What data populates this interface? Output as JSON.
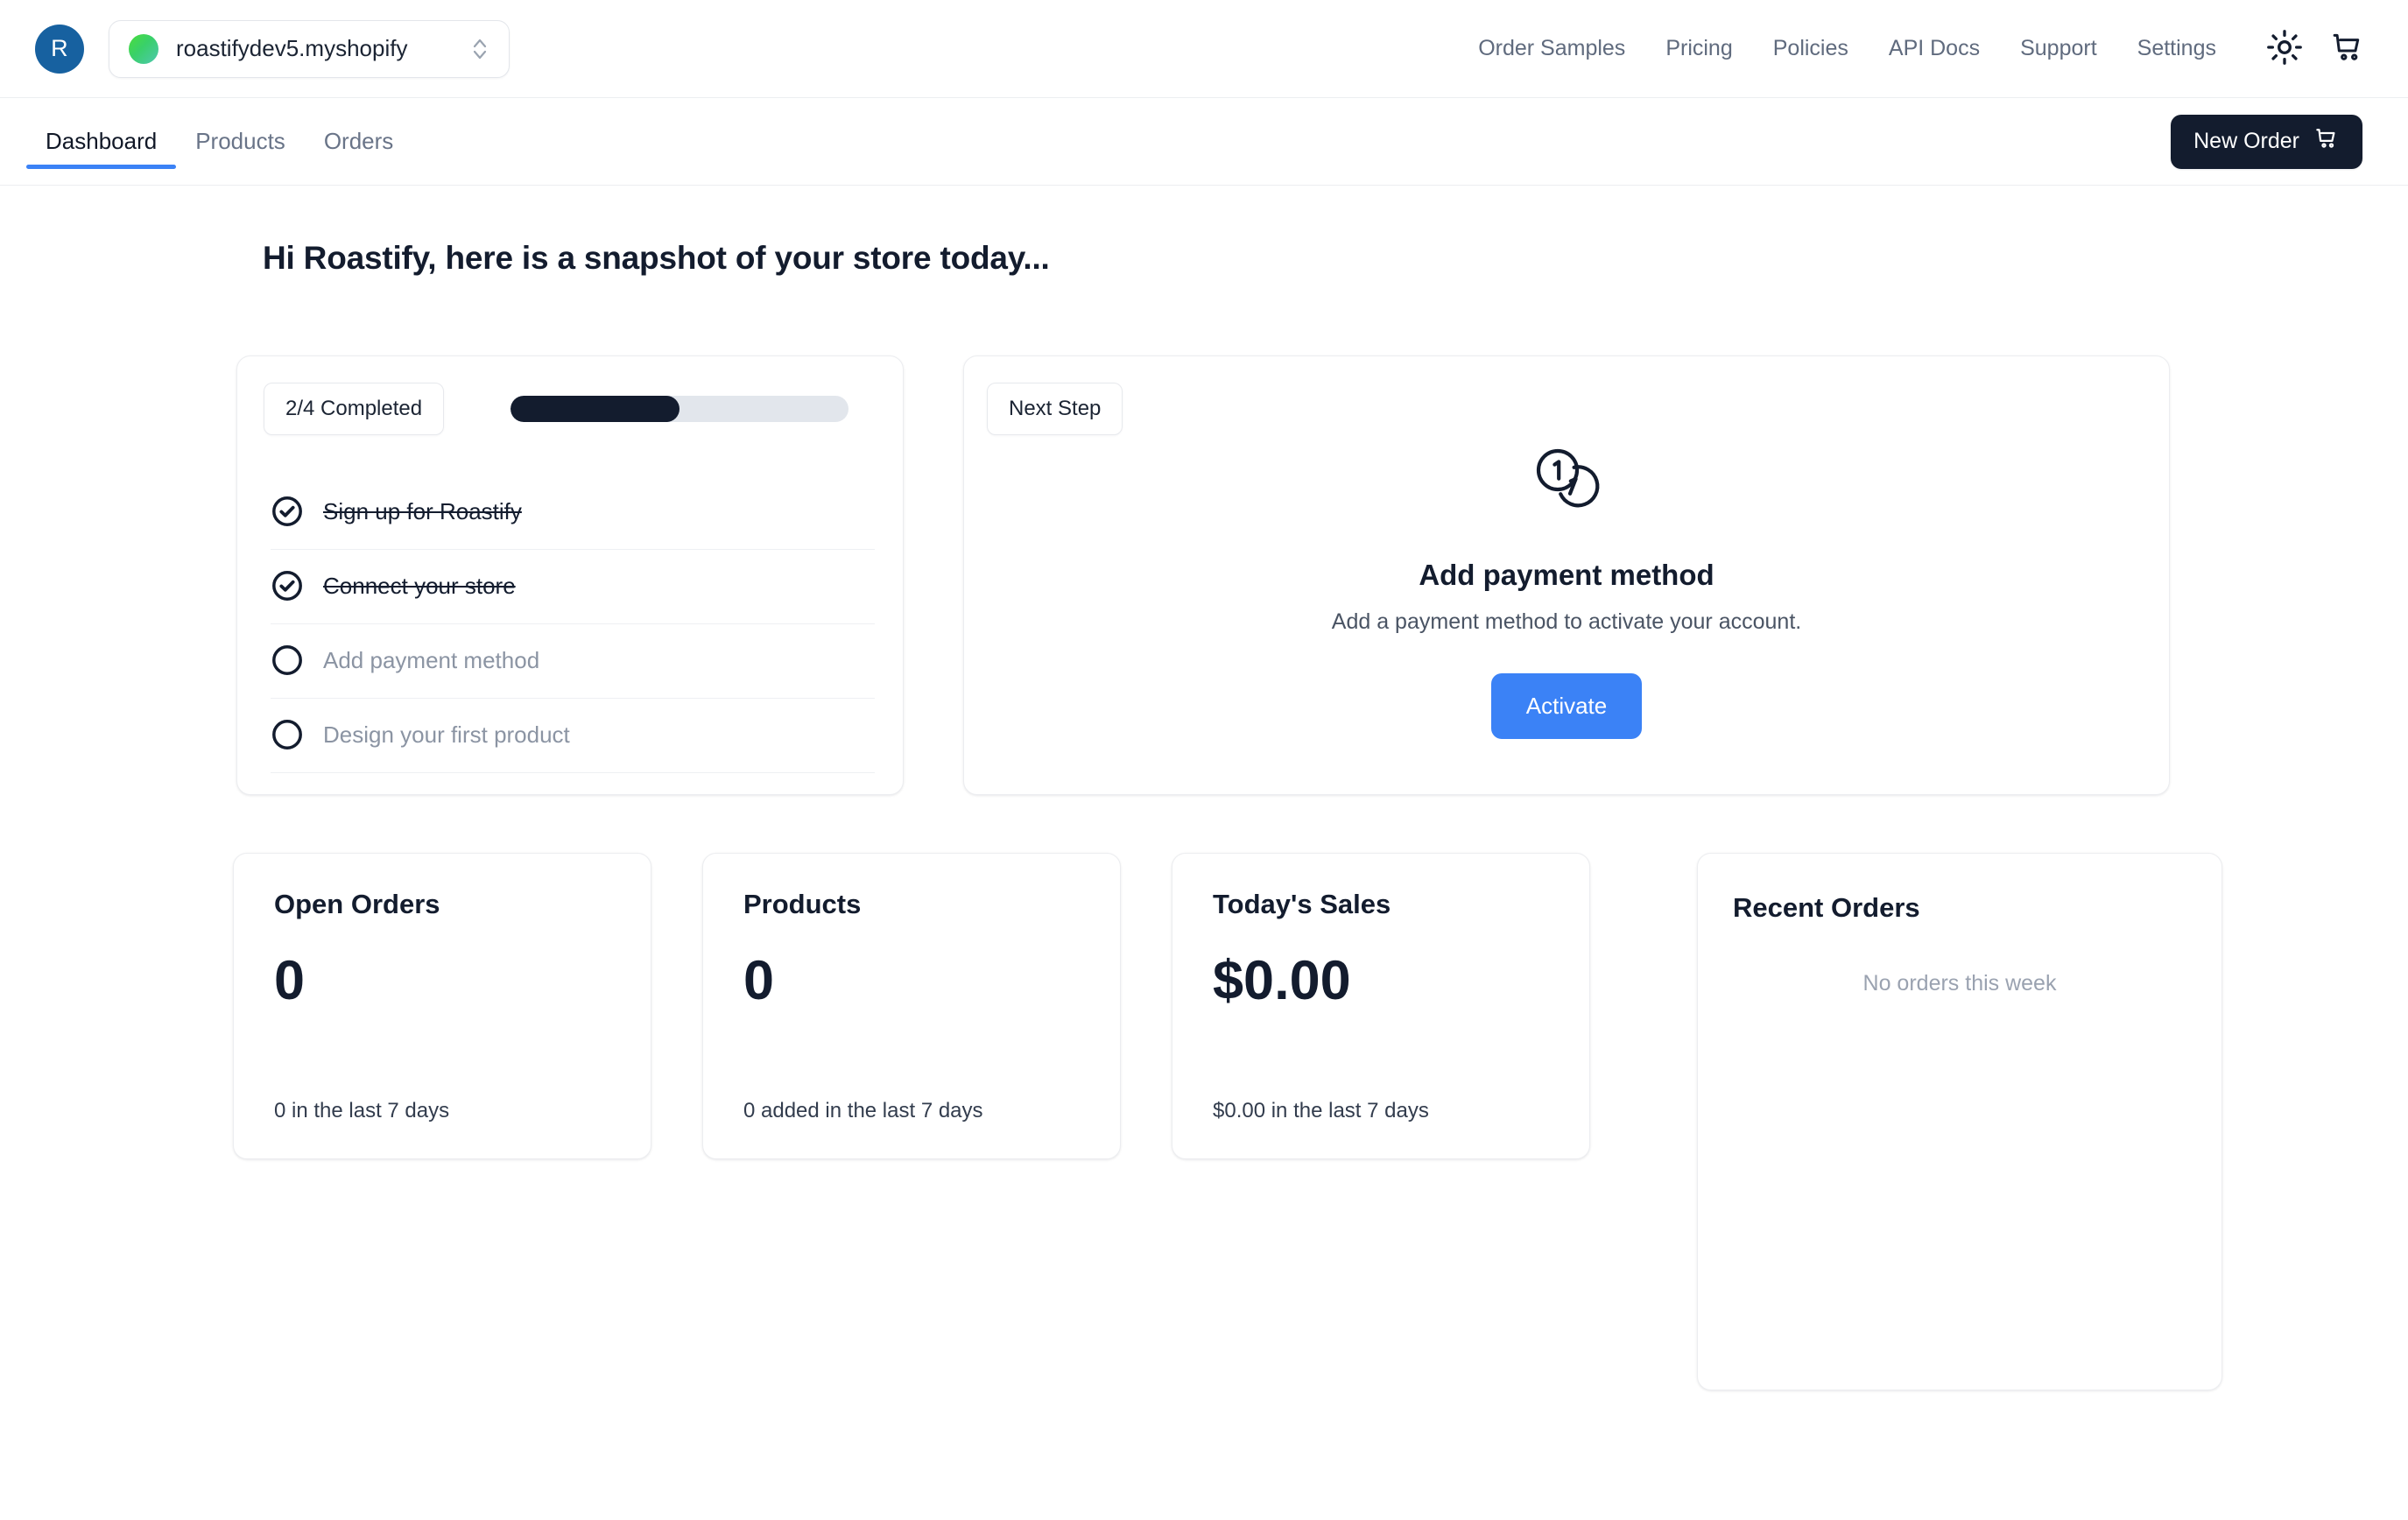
{
  "topbar": {
    "avatar_initial": "R",
    "store": {
      "name": "roastifydev5.myshopify",
      "status_dot": "online-status-dot",
      "chevron_icon": "chevron-up-down-icon"
    },
    "nav": [
      {
        "label": "Order Samples"
      },
      {
        "label": "Pricing"
      },
      {
        "label": "Policies"
      },
      {
        "label": "API Docs"
      },
      {
        "label": "Support"
      },
      {
        "label": "Settings"
      }
    ],
    "theme_toggle_icon": "sun-icon",
    "cart_icon": "shopping-cart-icon"
  },
  "tabbar": {
    "tabs": [
      {
        "label": "Dashboard",
        "active": true
      },
      {
        "label": "Products",
        "active": false
      },
      {
        "label": "Orders",
        "active": false
      }
    ],
    "new_order_label": "New Order",
    "new_order_icon": "shopping-cart-icon"
  },
  "main": {
    "page_title": "Hi Roastify, here is a snapshot of your store today...",
    "onboarding": {
      "badge": "2/4 Completed",
      "progress_percent": 50,
      "items": [
        {
          "label": "Sign up for Roastify",
          "done": true
        },
        {
          "label": "Connect your store",
          "done": true
        },
        {
          "label": "Add payment method",
          "done": false
        },
        {
          "label": "Design your first product",
          "done": false
        }
      ]
    },
    "next_step": {
      "badge": "Next Step",
      "icon": "coins-icon",
      "title": "Add payment method",
      "subtitle": "Add a payment method to activate your account.",
      "button_label": "Activate"
    },
    "stats": [
      {
        "title": "Open Orders",
        "value": "0",
        "sub": "0 in the last 7 days"
      },
      {
        "title": "Products",
        "value": "0",
        "sub": "0 added in the last 7 days"
      },
      {
        "title": "Today's Sales",
        "value": "$0.00",
        "sub": "$0.00 in the last 7 days"
      }
    ],
    "recent_orders": {
      "title": "Recent Orders",
      "empty_message": "No orders this week"
    }
  },
  "colors": {
    "accent_blue": "#3b82f6",
    "dark_navy": "#131c2e",
    "avatar_blue": "#1761a0",
    "muted_text": "#8b94a3"
  }
}
